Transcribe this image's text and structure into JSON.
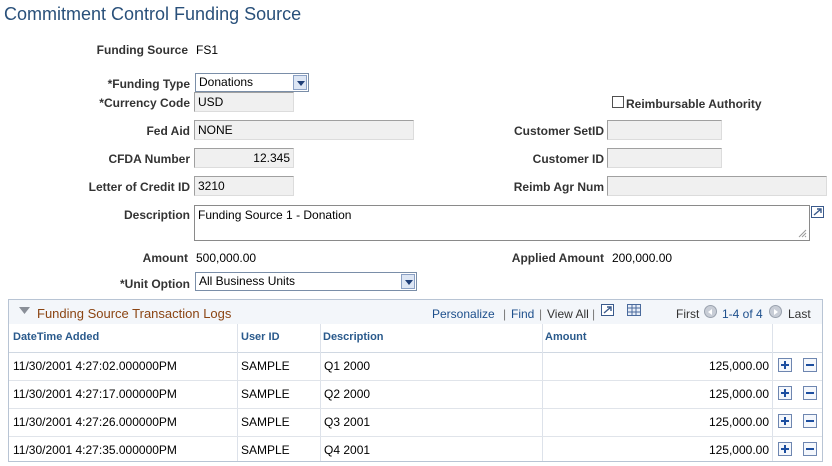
{
  "page": {
    "title": "Commitment Control Funding Source"
  },
  "form": {
    "funding_source_label": "Funding Source",
    "funding_source_value": "FS1",
    "funding_type_label": "*Funding Type",
    "funding_type_value": "Donations",
    "currency_code_label": "*Currency Code",
    "currency_code_value": "USD",
    "reimbursable_authority_label": "Reimbursable Authority",
    "fed_aid_label": "Fed Aid",
    "fed_aid_value": "NONE",
    "customer_setid_label": "Customer SetID",
    "customer_setid_value": "",
    "cfda_number_label": "CFDA Number",
    "cfda_number_value": "12.345",
    "customer_id_label": "Customer ID",
    "customer_id_value": "",
    "letter_of_credit_label": "Letter of Credit ID",
    "letter_of_credit_value": "3210",
    "reimb_agr_num_label": "Reimb Agr Num",
    "reimb_agr_num_value": "",
    "description_label": "Description",
    "description_value": "Funding Source 1 - Donation",
    "amount_label": "Amount",
    "amount_value": "500,000.00",
    "applied_amount_label": "Applied Amount",
    "applied_amount_value": "200,000.00",
    "unit_option_label": "*Unit Option",
    "unit_option_value": "All Business Units"
  },
  "grid": {
    "title": "Funding Source Transaction Logs",
    "personalize": "Personalize",
    "find": "Find",
    "view_all": "View All",
    "separator": "|",
    "first": "First",
    "range": "1-4 of 4",
    "last": "Last",
    "columns": [
      "DateTime Added",
      "User ID",
      "Description",
      "Amount"
    ],
    "rows": [
      {
        "datetime": "11/30/2001  4:27:02.000000PM",
        "user": "SAMPLE",
        "description": "Q1 2000",
        "amount": "125,000.00"
      },
      {
        "datetime": "11/30/2001  4:27:17.000000PM",
        "user": "SAMPLE",
        "description": "Q2 2000",
        "amount": "125,000.00"
      },
      {
        "datetime": "11/30/2001  4:27:26.000000PM",
        "user": "SAMPLE",
        "description": "Q3 2001",
        "amount": "125,000.00"
      },
      {
        "datetime": "11/30/2001  4:27:35.000000PM",
        "user": "SAMPLE",
        "description": "Q4 2001",
        "amount": "125,000.00"
      }
    ]
  },
  "colors": {
    "title": "#29507a",
    "grid_title": "#8b4513",
    "link": "#1d4f8c",
    "field_bg": "#f0f0f0"
  }
}
